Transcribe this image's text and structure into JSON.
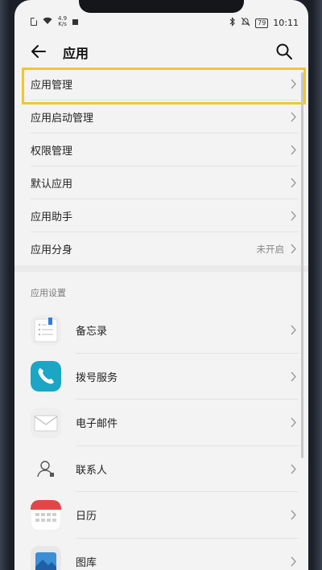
{
  "status_bar": {
    "network_speed_top": "4.9",
    "network_speed_unit": "K/s",
    "battery": "79",
    "time": "10:11"
  },
  "header": {
    "title": "应用"
  },
  "menu": [
    {
      "label": "应用管理",
      "value": ""
    },
    {
      "label": "应用启动管理",
      "value": ""
    },
    {
      "label": "权限管理",
      "value": ""
    },
    {
      "label": "默认应用",
      "value": ""
    },
    {
      "label": "应用助手",
      "value": ""
    },
    {
      "label": "应用分身",
      "value": "未开启"
    }
  ],
  "section": {
    "title": "应用设置"
  },
  "apps": [
    {
      "label": "备忘录",
      "icon": "notepad-icon"
    },
    {
      "label": "拨号服务",
      "icon": "phone-icon"
    },
    {
      "label": "电子邮件",
      "icon": "mail-icon"
    },
    {
      "label": "联系人",
      "icon": "contacts-icon"
    },
    {
      "label": "日历",
      "icon": "calendar-icon"
    },
    {
      "label": "图库",
      "icon": "gallery-icon"
    }
  ],
  "colors": {
    "highlight": "#f2c631",
    "phone_app": "#1aa6c4",
    "calendar_red": "#e04848"
  }
}
